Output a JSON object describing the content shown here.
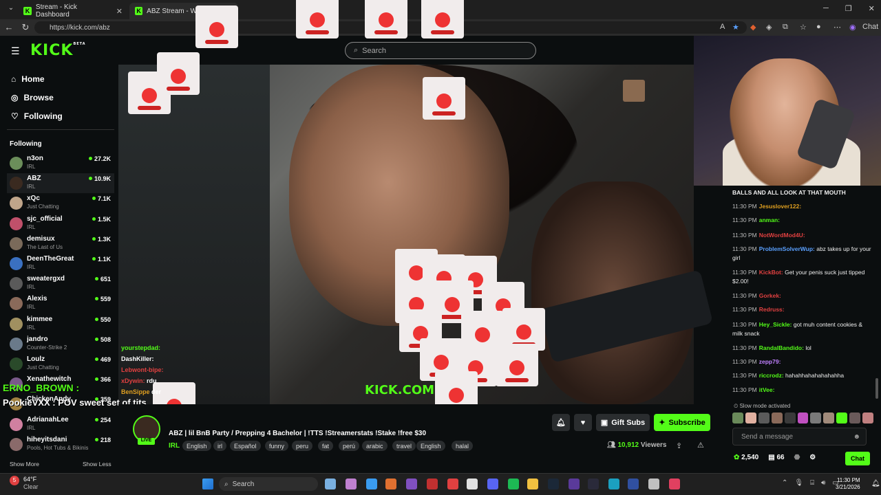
{
  "browser": {
    "tabs": [
      {
        "title": "Stream - Kick Dashboard"
      },
      {
        "title": "ABZ Stream - Watch Live on Kick"
      }
    ],
    "url": "https://kick.com/abz"
  },
  "header": {
    "logo": "KICK",
    "logo_badge": "BETA",
    "search_placeholder": "Search"
  },
  "nav": [
    {
      "label": "Home",
      "icon": "home-icon"
    },
    {
      "label": "Browse",
      "icon": "compass-icon"
    },
    {
      "label": "Following",
      "icon": "heart-icon"
    }
  ],
  "following": {
    "heading": "Following",
    "channels": [
      {
        "name": "n3on",
        "category": "IRL",
        "viewers": "27.2K",
        "color": "#6b8e5a"
      },
      {
        "name": "ABZ",
        "category": "IRL",
        "viewers": "10.9K",
        "color": "#3a2a20"
      },
      {
        "name": "xQc",
        "category": "Just Chatting",
        "viewers": "7.1K",
        "color": "#bfa58a"
      },
      {
        "name": "sjc_official",
        "category": "IRL",
        "viewers": "1.5K",
        "color": "#c0506a"
      },
      {
        "name": "demisux",
        "category": "The Last of Us",
        "viewers": "1.3K",
        "color": "#7a6a5a"
      },
      {
        "name": "DeenTheGreat",
        "category": "IRL",
        "viewers": "1.1K",
        "color": "#3a70c0"
      },
      {
        "name": "sweatergxd",
        "category": "IRL",
        "viewers": "651",
        "color": "#5a5a5a"
      },
      {
        "name": "Alexis",
        "category": "IRL",
        "viewers": "559",
        "color": "#8a6a5a"
      },
      {
        "name": "kimmee",
        "category": "IRL",
        "viewers": "550",
        "color": "#a09060"
      },
      {
        "name": "jandro",
        "category": "Counter-Strike 2",
        "viewers": "508",
        "color": "#6a7a8a"
      },
      {
        "name": "Loulz",
        "category": "Just Chatting",
        "viewers": "469",
        "color": "#2a4a2a"
      },
      {
        "name": "Xenathewitch",
        "category": "",
        "viewers": "366",
        "color": "#7a5a8a"
      },
      {
        "name": "ChickenAndy",
        "category": "",
        "viewers": "359",
        "color": "#a08040"
      },
      {
        "name": "AdrianahLee",
        "category": "IRL",
        "viewers": "254",
        "color": "#d080a0"
      },
      {
        "name": "hiheyitsdani",
        "category": "Pools, Hot Tubs & Bikinis",
        "viewers": "218",
        "color": "#8a6a6a"
      }
    ],
    "show_more": "Show More",
    "show_less": "Show Less"
  },
  "overlay": {
    "chat": [
      {
        "user": "yourstepdad:",
        "color": "#53fc18"
      },
      {
        "user": "DashKiller:",
        "color": "#ffffff"
      },
      {
        "user": "Lebwont-bipe:",
        "color": "#e04040"
      },
      {
        "user": "xDywin:",
        "color": "#e04040",
        "text": "rdu"
      },
      {
        "user": "BenSippe",
        "color": "#e0a020",
        "text": "der"
      }
    ],
    "watermark": "KICK.COM",
    "alert_name": "ERNO_BROWN :",
    "alert_msg": "PookieVXX : POV sweet set of tits"
  },
  "stream": {
    "title": "ABZ | lil BnB Party / Prepping 4 Bachelor | !TTS !Streamerstats !Stake !free $30",
    "category": "IRL",
    "live_label": "LIVE",
    "tags": [
      "English",
      "irl",
      "Español",
      "funny",
      "peru",
      "fat",
      "perú",
      "arabic",
      "travel",
      "English",
      "halal"
    ],
    "gift_label": "Gift Subs",
    "subscribe_label": "Subscribe",
    "viewers": "10,912",
    "viewers_label": "Viewers"
  },
  "chat": {
    "top_line": "BALLS AND ALL LOOK AT THAT MOUTH",
    "messages": [
      {
        "time": "11:30 PM",
        "user": "Jesuslover122:",
        "text": "",
        "color": "#e0a020"
      },
      {
        "time": "11:30 PM",
        "user": "anman:",
        "text": "",
        "color": "#53fc18"
      },
      {
        "time": "11:30 PM",
        "user": "NotWordMod4U:",
        "text": "",
        "color": "#e04040"
      },
      {
        "time": "11:30 PM",
        "user": "ProblemSolverWup:",
        "text": "abz takes up for your girl",
        "color": "#5aa0ff"
      },
      {
        "time": "11:30 PM",
        "user": "KickBot:",
        "text": "Get your penis suck just tipped $2.00!",
        "color": "#e04040"
      },
      {
        "time": "11:30 PM",
        "user": "Gorkek:",
        "text": "",
        "color": "#e04040"
      },
      {
        "time": "11:30 PM",
        "user": "Redruss:",
        "text": "",
        "color": "#e04040"
      },
      {
        "time": "11:30 PM",
        "user": "Hey_Sickle:",
        "text": "got muh content cookies & milk snack",
        "color": "#53fc18"
      },
      {
        "time": "11:30 PM",
        "user": "RandalBandido:",
        "text": "lol",
        "color": "#53fc18"
      },
      {
        "time": "11:30 PM",
        "user": "zepp79:",
        "text": "",
        "color": "#c080ff"
      },
      {
        "time": "11:30 PM",
        "user": "riccrodz:",
        "text": "hahahhahahahahahha",
        "color": "#53fc18"
      },
      {
        "time": "11:30 PM",
        "user": "itVee:",
        "text": "",
        "color": "#53fc18"
      }
    ],
    "slow_mode": "Slow mode activated",
    "input_placeholder": "Send a message",
    "points": "2,540",
    "gifts": "66",
    "send_label": "Chat"
  },
  "taskbar": {
    "weather_temp": "64°F",
    "weather_desc": "Clear",
    "weather_badge": "5",
    "search": "Search",
    "time": "11:30 PM",
    "date": "3/21/2026"
  }
}
